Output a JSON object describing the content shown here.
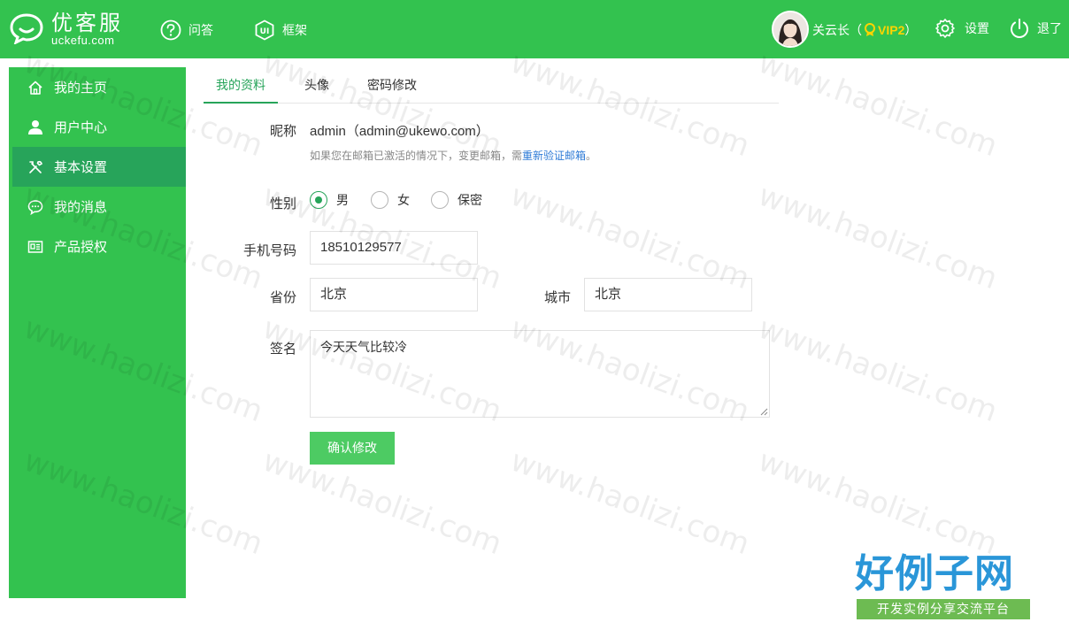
{
  "header": {
    "logo_name": "优客服",
    "logo_domain": "uckefu.com",
    "nav": [
      {
        "label": "问答",
        "icon": "help-circle-icon"
      },
      {
        "label": "框架",
        "icon": "ui-icon"
      }
    ],
    "user": {
      "name": "关云长（",
      "vip": "VIP2",
      "suffix": "）"
    },
    "settings_label": "设置",
    "logout_label": "退了"
  },
  "sidebar": {
    "items": [
      {
        "label": "我的主页",
        "icon": "home-icon",
        "active": false
      },
      {
        "label": "用户中心",
        "icon": "user-icon",
        "active": false
      },
      {
        "label": "基本设置",
        "icon": "tools-icon",
        "active": true
      },
      {
        "label": "我的消息",
        "icon": "message-icon",
        "active": false
      },
      {
        "label": "产品授权",
        "icon": "license-icon",
        "active": false
      }
    ]
  },
  "tabs": [
    {
      "label": "我的资料",
      "active": true
    },
    {
      "label": "头像",
      "active": false
    },
    {
      "label": "密码修改",
      "active": false
    }
  ],
  "form": {
    "nickname_label": "昵称",
    "nickname_value": "admin（admin@ukewo.com）",
    "hint_text": "如果您在邮箱已激活的情况下，变更邮箱，需",
    "hint_link": "重新验证邮箱",
    "hint_end": "。",
    "gender_label": "性别",
    "gender_options": [
      {
        "label": "男",
        "checked": true
      },
      {
        "label": "女",
        "checked": false
      },
      {
        "label": "保密",
        "checked": false
      }
    ],
    "phone_label": "手机号码",
    "phone_value": "18510129577",
    "province_label": "省份",
    "province_value": "北京",
    "city_label": "城市",
    "city_value": "北京",
    "signature_label": "签名",
    "signature_value": "今天天气比较冷",
    "submit_label": "确认修改"
  },
  "watermark_text": "www.haolizi.com",
  "badge": {
    "title": "好例子网",
    "subtitle": "开发实例分享交流平台"
  },
  "colors": {
    "brand_green": "#33c24f",
    "active_green": "#27a45a",
    "button_green": "#4dcb63",
    "vip_yellow": "#ffd400",
    "link_blue": "#2f7bd6"
  }
}
